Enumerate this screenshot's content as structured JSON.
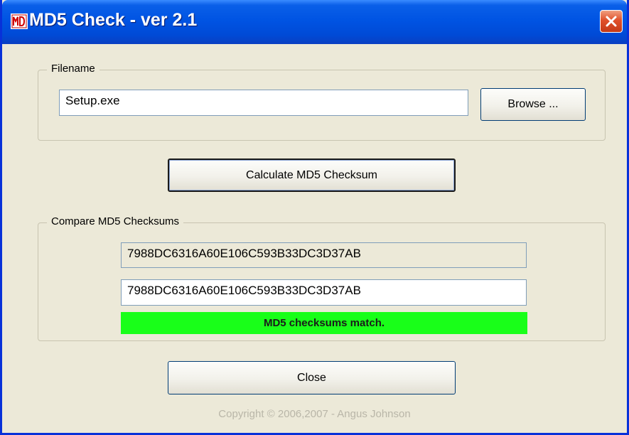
{
  "window": {
    "title": "MD5 Check - ver 2.1",
    "icon": "md5-app-icon",
    "close_icon": "close-icon"
  },
  "filename_group": {
    "label": "Filename",
    "value": "Setup.exe",
    "browse_label": "Browse ..."
  },
  "calculate_label": "Calculate MD5 Checksum",
  "compare_group": {
    "label": "Compare MD5 Checksums",
    "computed_checksum": "7988DC6316A60E106C593B33DC3D37AB",
    "expected_checksum": "7988DC6316A60E106C593B33DC3D37AB",
    "status_text": "MD5 checksums match.",
    "status_color": "#19ff19"
  },
  "close_label": "Close",
  "copyright": "Copyright © 2006,2007 - Angus Johnson",
  "colors": {
    "titlebar": "#0054e3",
    "window_bg": "#ece9d8",
    "close_button": "#e0502a"
  }
}
